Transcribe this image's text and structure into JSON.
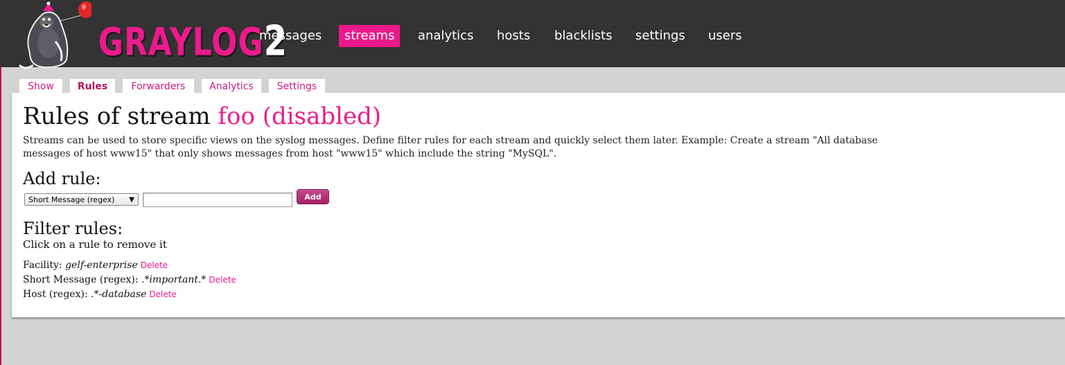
{
  "header": {
    "logo_text": "GRAYLOG",
    "logo_number": "2",
    "nav": [
      {
        "label": "messages",
        "active": false
      },
      {
        "label": "streams",
        "active": true
      },
      {
        "label": "analytics",
        "active": false
      },
      {
        "label": "hosts",
        "active": false
      },
      {
        "label": "blacklists",
        "active": false
      },
      {
        "label": "settings",
        "active": false
      },
      {
        "label": "users",
        "active": false
      }
    ]
  },
  "tabs": [
    {
      "label": "Show",
      "active": false
    },
    {
      "label": "Rules",
      "active": true
    },
    {
      "label": "Forwarders",
      "active": false
    },
    {
      "label": "Analytics",
      "active": false
    },
    {
      "label": "Settings",
      "active": false
    }
  ],
  "page": {
    "title_prefix": "Rules of stream",
    "stream_name": "foo (disabled)",
    "description": "Streams can be used to store specific views on the syslog messages. Define filter rules for each stream and quickly select them later. Example: Create a stream \"All database messages of host www15\" that only shows messages from host \"www15\" which include the string \"MySQL\".",
    "add_rule_heading": "Add rule:",
    "rule_type_selected": "Short Message (regex)",
    "rule_value": "",
    "add_button": "Add",
    "filter_rules_heading": "Filter rules:",
    "filter_rules_hint": "Click on a rule to remove it",
    "rules": [
      {
        "label": "Facility:",
        "value": "gelf-enterprise",
        "delete": "Delete"
      },
      {
        "label": "Short Message (regex):",
        "value": ".*important.*",
        "delete": "Delete"
      },
      {
        "label": "Host (regex):",
        "value": ".*-database",
        "delete": "Delete"
      }
    ]
  },
  "colors": {
    "accent": "#ec1a8c",
    "header_bg": "#333333",
    "page_bg": "#d3d3d3",
    "button": "#b02a6e"
  }
}
